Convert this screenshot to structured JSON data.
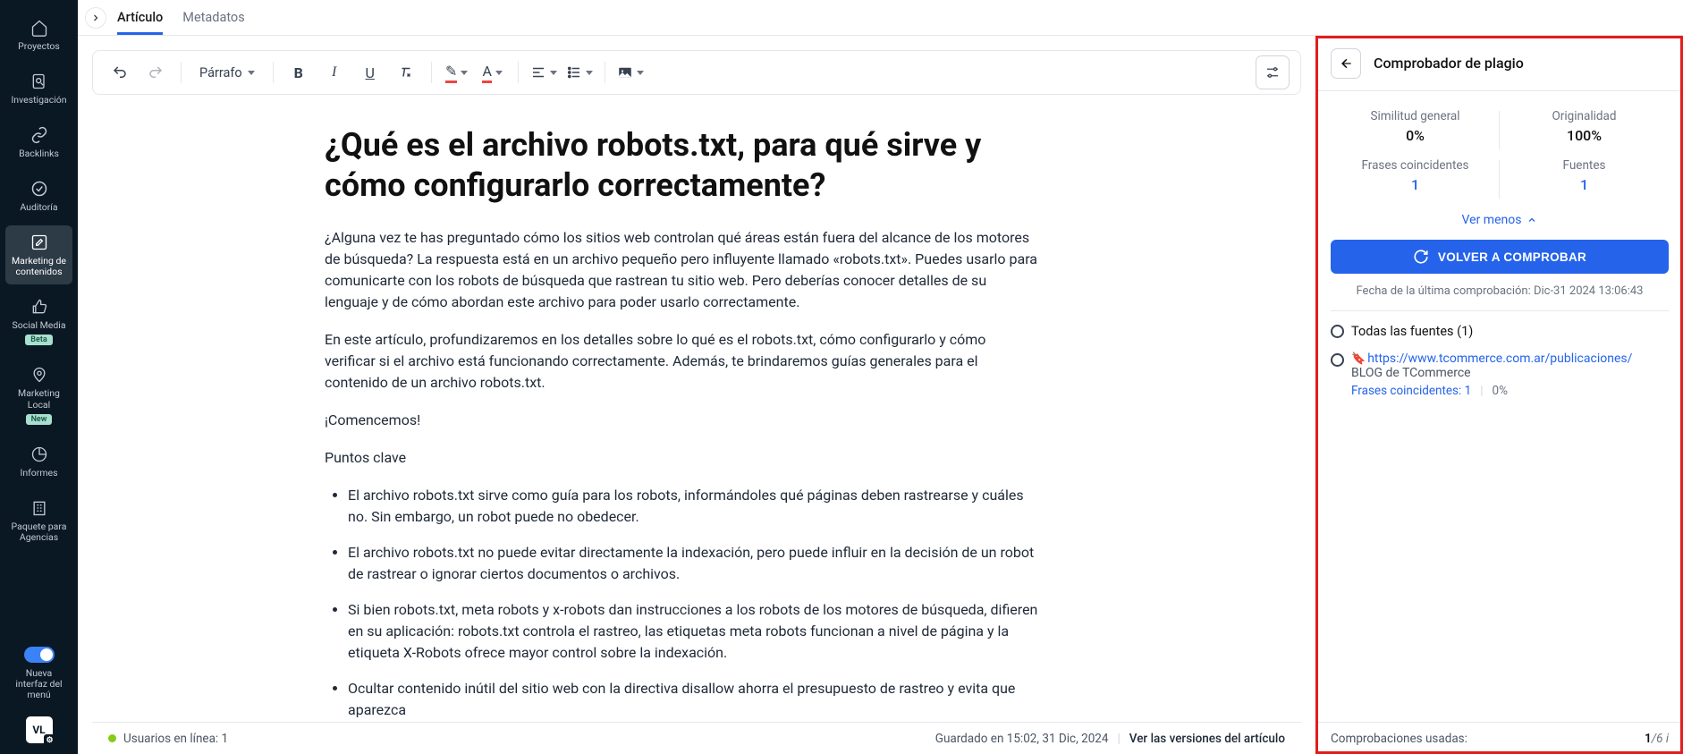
{
  "sidebar": {
    "items": [
      {
        "label": "Proyectos"
      },
      {
        "label": "Investigación"
      },
      {
        "label": "Backlinks"
      },
      {
        "label": "Auditoría"
      },
      {
        "label": "Marketing de contenidos"
      },
      {
        "label": "Social Media",
        "badge": "Beta"
      },
      {
        "label": "Marketing Local",
        "badge": "New"
      },
      {
        "label": "Informes"
      },
      {
        "label": "Paquete para Agencias"
      }
    ],
    "toggle_label": "Nueva interfaz del menú",
    "avatar": "VL"
  },
  "tabs": {
    "article": "Artículo",
    "metadata": "Metadatos"
  },
  "toolbar": {
    "paragraph": "Párrafo"
  },
  "article": {
    "title": "¿Qué es el archivo robots.txt, para qué sirve y cómo configurarlo correctamente?",
    "p1": "¿Alguna vez te has preguntado cómo los sitios web controlan qué áreas están fuera del alcance de los motores de búsqueda? La respuesta está en un archivo pequeño pero influyente llamado «robots.txt». Puedes usarlo para comunicarte con los robots de búsqueda que rastrean tu sitio web. Pero deberías conocer detalles de su lenguaje y de cómo abordan este archivo para poder usarlo correctamente.",
    "p2": "En este artículo, profundizaremos en los detalles sobre lo qué es el robots.txt, cómo configurarlo y cómo verificar si el archivo está funcionando correctamente. Además, te brindaremos guías generales para el contenido de un archivo robots.txt.",
    "p3": "¡Comencemos!",
    "p4": "Puntos clave",
    "li1": "El archivo robots.txt sirve como guía para los robots, informándoles qué páginas deben rastrearse y cuáles no. Sin embargo, un robot puede no obedecer.",
    "li2": "El archivo robots.txt no puede evitar directamente la indexación, pero puede influir en la decisión de un robot de rastrear o ignorar ciertos documentos o archivos.",
    "li3": "Si bien robots.txt, meta robots y x-robots dan instrucciones a los robots de los motores de búsqueda, difieren en su aplicación: robots.txt controla el rastreo, las etiquetas meta robots funcionan a nivel de página y la etiqueta X-Robots ofrece mayor control sobre la indexación.",
    "li4": "Ocultar contenido inútil del sitio web con la directiva disallow ahorra el presupuesto de rastreo y evita que aparezca"
  },
  "footer": {
    "users_online": "Usuarios en línea: 1",
    "saved": "Guardado en 15:02, 31 Dic, 2024",
    "versions": "Ver las versiones del artículo"
  },
  "panel": {
    "title": "Comprobador de plagio",
    "stat_similarity_lbl": "Similitud general",
    "stat_similarity_val": "0%",
    "stat_originality_lbl": "Originalidad",
    "stat_originality_val": "100%",
    "stat_matches_lbl": "Frases coincidentes",
    "stat_matches_val": "1",
    "stat_sources_lbl": "Fuentes",
    "stat_sources_val": "1",
    "ver_menos": "Ver menos",
    "recheck": "VOLVER A COMPROBAR",
    "last_check": "Fecha de la última comprobación: Dic-31 2024 13:06:43",
    "all_sources": "Todas las fuentes (1)",
    "source": {
      "url": "https://www.tcommerce.com.ar/publicaciones/",
      "name": "BLOG de TCommerce",
      "matches": "Frases coincidentes: 1",
      "pct": "0%"
    },
    "footer_label": "Comprobaciones usadas:",
    "footer_used": "1",
    "footer_total": "/6"
  }
}
